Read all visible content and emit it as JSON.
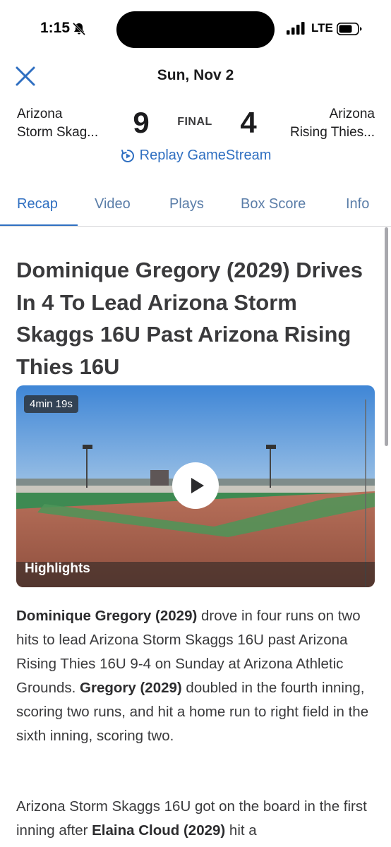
{
  "status_bar": {
    "time": "1:15",
    "network": "LTE",
    "icons": [
      "bell-muted-icon",
      "signal-icon",
      "battery-icon"
    ]
  },
  "header": {
    "date": "Sun, Nov 2",
    "close_icon": "close-icon"
  },
  "scoreboard": {
    "home_name_line1": "Arizona",
    "home_name_line2": "Storm Skag...",
    "home_score": "9",
    "status": "FINAL",
    "away_score": "4",
    "away_name_line1": "Arizona",
    "away_name_line2": "Rising Thies..."
  },
  "replay": {
    "label": "Replay GameStream",
    "icon": "replay-icon"
  },
  "tabs": [
    {
      "label": "Recap",
      "active": true
    },
    {
      "label": "Video",
      "active": false
    },
    {
      "label": "Plays",
      "active": false
    },
    {
      "label": "Box Score",
      "active": false
    },
    {
      "label": "Info",
      "active": false
    }
  ],
  "article": {
    "headline": "Dominique Gregory (2029) Drives In 4 To Lead Arizona Storm Skaggs 16U Past Arizona Rising Thies 16U",
    "video": {
      "duration": "4min 19s",
      "label": "Highlights"
    },
    "paragraph1": {
      "bold1": "Dominique Gregory (2029)",
      "text1": " drove in four runs on two hits to lead Arizona Storm Skaggs 16U past Arizona Rising Thies 16U 9-4 on Sunday at Arizona Athletic Grounds. ",
      "bold2": "Gregory (2029)",
      "text2": " doubled in the fourth inning, scoring two runs, and hit a home run to right field in the sixth inning, scoring two."
    },
    "paragraph2": {
      "text1": "Arizona Storm Skaggs 16U got on the board in the first inning after ",
      "bold1": "Elaina Cloud (2029)",
      "text2": " hit a"
    }
  },
  "colors": {
    "accent": "#2f6fc1",
    "tab_inactive": "#5a7da8",
    "text": "#3a3a3c"
  }
}
